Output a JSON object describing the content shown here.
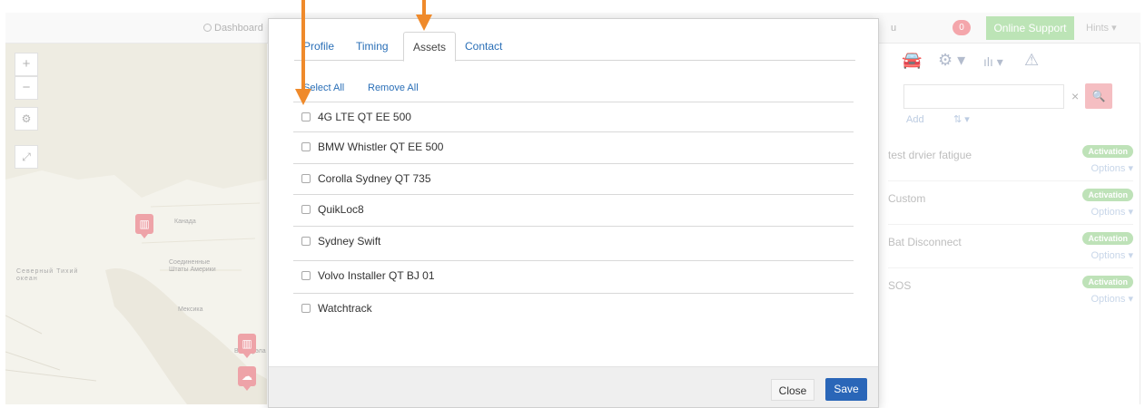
{
  "navbar": {
    "dashboard_label": "Dashboard",
    "fragment_label": "u",
    "notification_count": "0",
    "online_support_label": "Online Support",
    "hints_label": "Hints ▾"
  },
  "map": {
    "zoom_in": "+",
    "zoom_out": "−",
    "labels": {
      "canada": "Канада",
      "usa": "Соединенные Штаты Америки",
      "pacific": "Северный Тихий океан",
      "mexico": "Мексика",
      "venezuela": "Венесуэла"
    }
  },
  "right_panel": {
    "add_label": "Add",
    "sort_label": "⇅ ▾",
    "clear_label": "×",
    "rows": [
      {
        "name": "test drvier fatigue",
        "badge": "Activation",
        "options": "Options ▾"
      },
      {
        "name": "Custom",
        "badge": "Activation",
        "options": "Options ▾"
      },
      {
        "name": "Bat Disconnect",
        "badge": "Activation",
        "options": "Options ▾"
      },
      {
        "name": "SOS",
        "badge": "Activation",
        "options": "Options ▾"
      }
    ]
  },
  "modal": {
    "tabs": [
      "Profile",
      "Timing",
      "Assets",
      "Contact"
    ],
    "active_tab": "Assets",
    "select_all_label": "Select All",
    "remove_all_label": "Remove All",
    "assets": [
      "4G LTE QT EE 500",
      "BMW Whistler QT EE 500",
      "Corolla Sydney QT 735",
      "QuikLoc8",
      "Sydney Swift",
      "Volvo Installer QT BJ 01",
      "Watchtrack"
    ],
    "close_label": "Close",
    "save_label": "Save"
  },
  "colors": {
    "accent_blue": "#2a66b8",
    "link_blue": "#2a6fb7",
    "success_green": "#a6db9e",
    "alert_red": "#f1898f",
    "annotation_orange": "#ef8a2b"
  }
}
